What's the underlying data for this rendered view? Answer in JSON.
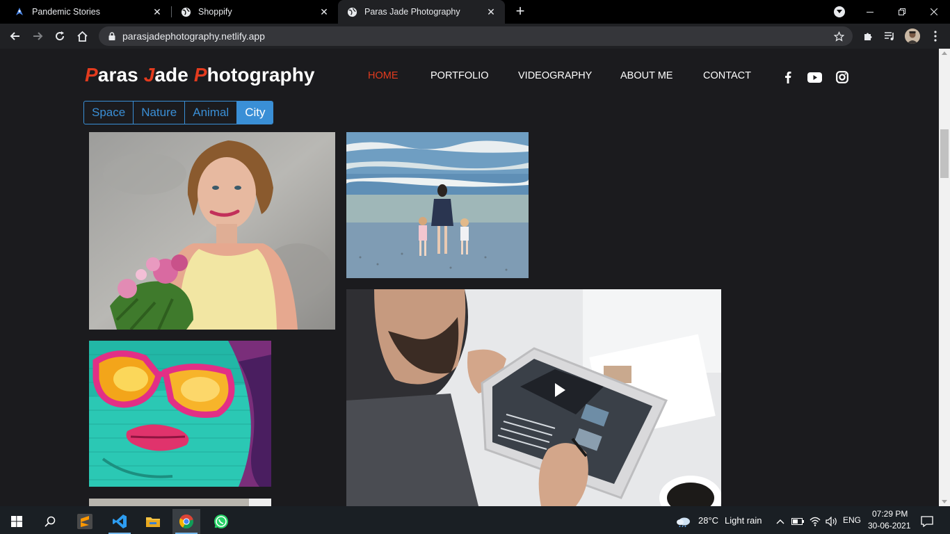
{
  "browser": {
    "tabs": [
      {
        "title": "Pandemic Stories",
        "icon": "paper-plane-icon"
      },
      {
        "title": "Shoppify",
        "icon": "globe-icon"
      },
      {
        "title": "Paras Jade Photography",
        "icon": "globe-icon",
        "active": true
      }
    ],
    "url": "parasjadephotography.netlify.app"
  },
  "site": {
    "logo": {
      "w1_cap": "P",
      "w1_rest": "aras ",
      "w2_cap": "J",
      "w2_rest": "ade ",
      "w3_cap": "P",
      "w3_rest": "hotography"
    },
    "nav": [
      {
        "label": "HOME",
        "active": true
      },
      {
        "label": "PORTFOLIO"
      },
      {
        "label": "VIDEOGRAPHY"
      },
      {
        "label": "ABOUT ME"
      },
      {
        "label": "CONTACT"
      }
    ],
    "social_icons": [
      "facebook-icon",
      "youtube-icon",
      "instagram-icon"
    ],
    "filters": [
      {
        "label": "Space"
      },
      {
        "label": "Nature"
      },
      {
        "label": "Animal"
      },
      {
        "label": "City",
        "active": true
      }
    ],
    "colors": {
      "accent": "#e33b1e",
      "filter_blue": "#3a8fd6",
      "background": "#1b1b1e"
    },
    "gallery": [
      "woman-with-flowers-photo",
      "beach-family-photo",
      "graffiti-face-photo",
      "man-with-tablet-photo",
      "partial-photo"
    ]
  },
  "taskbar": {
    "weather": {
      "temp": "28°C",
      "desc": "Light rain"
    },
    "lang": "ENG",
    "time": "07:29 PM",
    "date": "30-06-2021"
  }
}
